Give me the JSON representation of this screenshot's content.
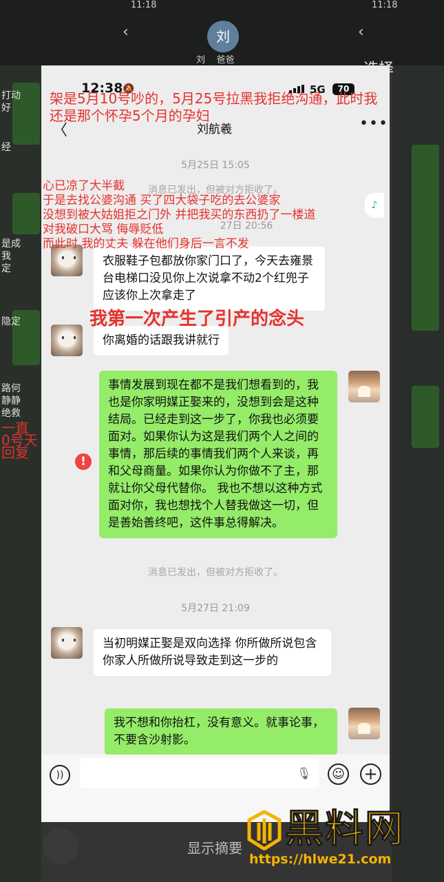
{
  "background": {
    "status_time_1": "11:18",
    "status_time_2": "11:18",
    "avatar_initial": "刘",
    "contact_name": "刘",
    "contact_name_suffix": "爸爸",
    "select_label": "选择",
    "bottom_button": "显示摘要",
    "left_fragments": [
      "打动",
      "好",
      "经",
      "是成",
      "我",
      "定",
      "隐定",
      "路何",
      "静静",
      "绝救"
    ],
    "left_red_fragments": [
      "一直",
      "0号天",
      "回复"
    ]
  },
  "status_bar": {
    "time": "12:38",
    "network": "5G",
    "battery": "70"
  },
  "nav": {
    "title": "刘航羲",
    "back_icon": "chevron-left-icon",
    "more_icon": "more-icon"
  },
  "chat": {
    "timestamp_1": "5月25日 15:05",
    "rejected_1": "消息已发出，但被对方拒收了。",
    "timestamp_2_partial": "27日 20:56",
    "msg_in_1": "衣服鞋子包都放你家门口了，今天去雍景台电梯口没见你上次说拿不动2个红兜子 应该你上次拿走了",
    "msg_in_2": "你离婚的话跟我讲就行",
    "msg_out_1": "事情发展到现在都不是我们想看到的，我也是你家明媒正娶来的，没想到会是这种结局。已经走到这一步了，你我也必须要面对。如果你认为这是我们两个人之间的事情，那后续的事情我们两个人来谈，再和父母商量。如果你认为你做不了主，那就让你父母代替你。 我也不想以这种方式面对你，我也想找个人替我做这一切，但是善始善终吧，这件事总得解决。",
    "rejected_2": "消息已发出，但被对方拒收了。",
    "timestamp_3": "5月27日 21:09",
    "msg_in_3": "当初明媒正娶是双向选择 你所做所说包含你家人所做所说导致走到这一步的",
    "msg_out_2": "我不想和你抬杠，没有意义。就事论事，不要含沙射影。"
  },
  "input_bar": {
    "placeholder": ""
  },
  "annotations": {
    "top": "架是5月10号吵的，5月25号拉黑我拒绝沟通，此时我还是那个怀孕5个月的孕妇",
    "mid_lines": [
      "心已凉了大半截",
      "于是去找公婆沟通 买了四大袋子吃的去公婆家",
      "没想到被大姑姐拒之门外 并把我买的东西扔了一楼道",
      "对我破口大骂 侮辱贬低",
      "而此时 我的丈夫 躲在他们身后一言不发"
    ],
    "big": "我第一次产生了引产的念头"
  },
  "watermark": {
    "title": "黑料网",
    "url": "https://hlwe21.com",
    "color": "#f6b400"
  }
}
